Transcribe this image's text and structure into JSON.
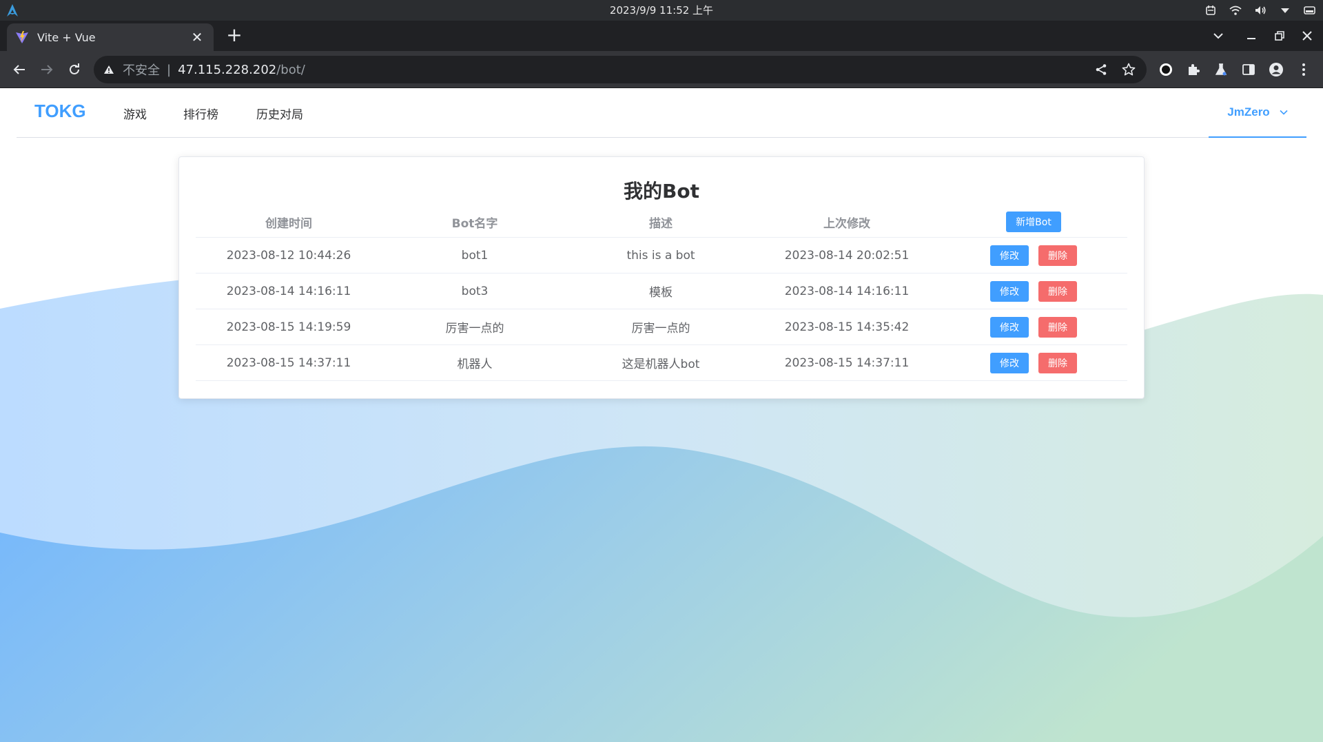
{
  "os": {
    "clock": "2023/9/9   11:52 上午",
    "tray_icons": [
      "calendar-icon",
      "wifi-icon",
      "volume-icon",
      "dropdown-icon",
      "battery-icon"
    ]
  },
  "browser": {
    "tab_title": "Vite + Vue",
    "new_tab": "+",
    "close_tab": "✕",
    "url_security": "不安全",
    "url_separator": "|",
    "url_host": "47.115.228.202",
    "url_path": "/bot/"
  },
  "nav": {
    "brand": "TOKG",
    "items": [
      "游戏",
      "排行榜",
      "历史对局"
    ],
    "user": "JmZero"
  },
  "card": {
    "title": "我的Bot",
    "headers": [
      "创建时间",
      "Bot名字",
      "描述",
      "上次修改"
    ],
    "add_button": "新增Bot",
    "edit_label": "修改",
    "delete_label": "删除",
    "rows": [
      [
        "2023-08-12 10:44:26",
        "bot1",
        "this is a bot",
        "2023-08-14 20:02:51"
      ],
      [
        "2023-08-14 14:16:11",
        "bot3",
        "模板",
        "2023-08-14 14:16:11"
      ],
      [
        "2023-08-15 14:19:59",
        "厉害一点的",
        "厉害一点的",
        "2023-08-15 14:35:42"
      ],
      [
        "2023-08-15 14:37:11",
        "机器人",
        "这是机器人bot",
        "2023-08-15 14:37:11"
      ]
    ]
  },
  "colors": {
    "primary": "#409eff",
    "danger": "#f56c6c",
    "text": "#606266",
    "header_text": "#909399"
  }
}
